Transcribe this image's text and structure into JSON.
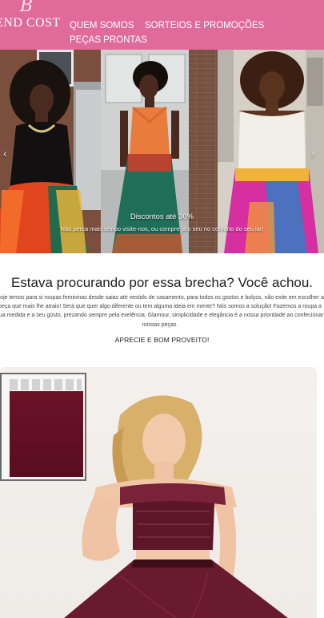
{
  "brand": {
    "logo_text": "END COST",
    "logo_mark": "B"
  },
  "nav": {
    "items": [
      {
        "label": "QUEM SOMOS"
      },
      {
        "label": "SORTEIOS E PROMOÇÕES"
      },
      {
        "label": "PEÇAS PRONTAS"
      }
    ]
  },
  "hero": {
    "title": "Discontos até 30%",
    "subtitle": "Não perca mais tempo visite-nos, ou compre já o seu no conforto do seu lar!"
  },
  "intro": {
    "headline": "Estava procurando por essa brecha? Você achou.",
    "body": "Hoje temos para si roupas femininas desde saias até vestido de casamento, para todos os gostos e bolços, não exite em escolher a peça que mais lhe atraio! Será que quer algo diferente ou tem alguma ideia em mente? Nós somos a solução! Fazemos a roupa a sua medida e a seu gosto, prezando sempre pela exelência. Glamour, simplicidade e elegância é a nossa prioridade ao confecionar nossas peças.",
    "cta": "APRECIE E BOM PROVEITO!"
  },
  "colors": {
    "header_bg": "#e06a9a",
    "swatch": "#6b1227",
    "dress": "#5f1326"
  },
  "icons": {
    "prev": "chevron-left-icon",
    "next": "chevron-right-icon"
  }
}
